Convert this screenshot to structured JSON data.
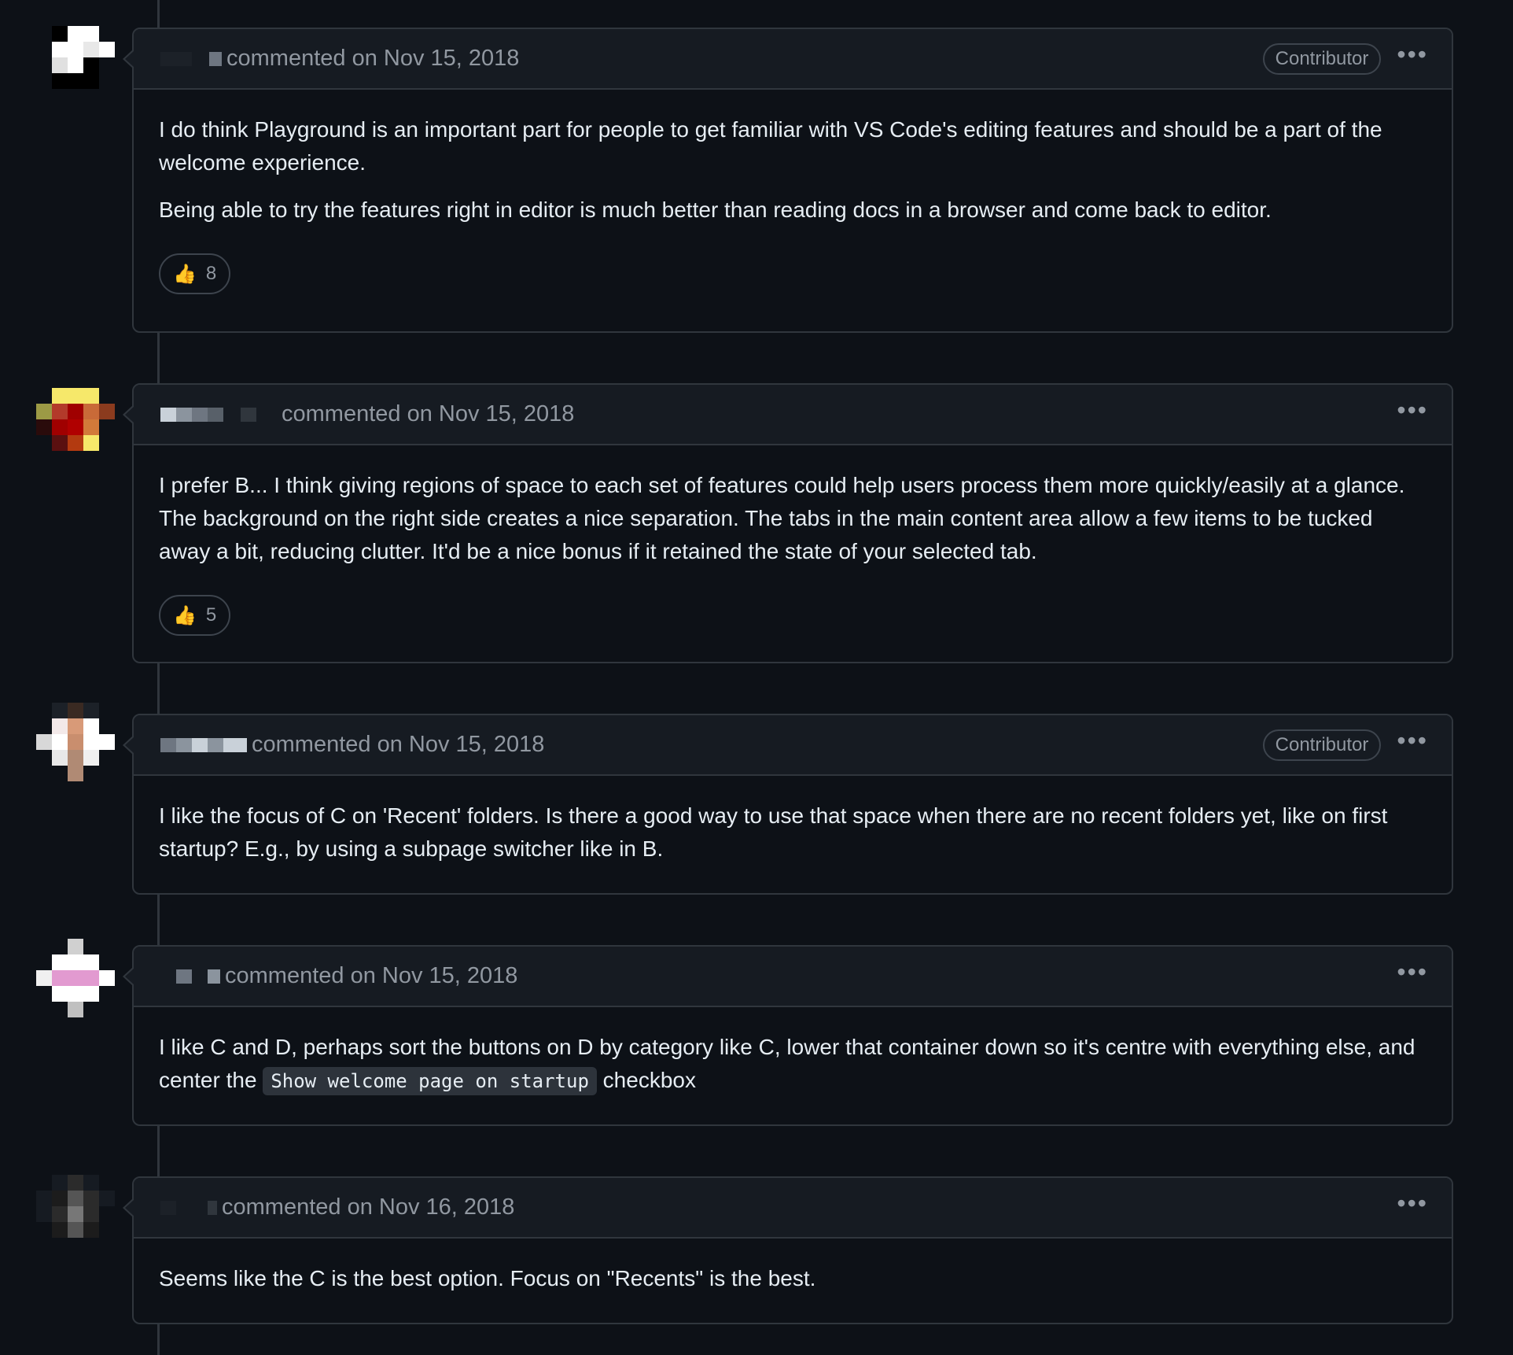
{
  "comments": [
    {
      "action": "commented on Nov 15, 2018",
      "badge": "Contributor",
      "paragraphs": [
        "I do think Playground is an important part for people to get familiar with VS Code's editing features and should be a part of the welcome experience.",
        "Being able to try the features right in editor is much better than reading docs in a browser and come back to editor."
      ],
      "reaction": {
        "icon": "thumbs-up-icon",
        "count": "8"
      }
    },
    {
      "action": "commented on Nov 15, 2018",
      "paragraphs": [
        "I prefer B... I think giving regions of space to each set of features could help users process them more quickly/easily at a glance. The background on the right side creates a nice separation. The tabs in the main content area allow a few items to be tucked away a bit, reducing clutter. It'd be a nice bonus if it retained the state of your selected tab."
      ],
      "reaction": {
        "icon": "thumbs-up-icon",
        "count": "5"
      }
    },
    {
      "action": "commented on Nov 15, 2018",
      "badge": "Contributor",
      "paragraphs": [
        "I like the focus of C on 'Recent' folders. Is there a good way to use that space when there are no recent folders yet, like on first startup? E.g., by using a subpage switcher like in B."
      ]
    },
    {
      "action": "commented on Nov 15, 2018",
      "text_before_code": "I like C and D, perhaps sort the buttons on D by category like C, lower that container down so it's centre with everything else, and center the",
      "code": "Show welcome page on startup",
      "text_after_code": "checkbox"
    },
    {
      "action": "commented on Nov 16, 2018",
      "paragraphs": [
        "Seems like the C is the best option. Focus on \"Recents\" is the best."
      ]
    }
  ],
  "menu_icon": "kebab-horizontal-icon",
  "colors": {
    "background": "#0d1117",
    "header_background": "#161b22",
    "border": "#30363d",
    "text": "#e6edf3",
    "muted": "#9198a1"
  }
}
